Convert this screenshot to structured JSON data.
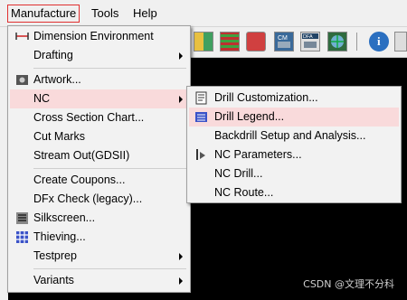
{
  "menubar": {
    "items": [
      "Manufacture",
      "Tools",
      "Help"
    ]
  },
  "main_menu": {
    "items": [
      {
        "label": "Dimension Environment",
        "icon": "dimension-icon"
      },
      {
        "label": "Drafting",
        "submenu": true
      },
      {
        "label": "Artwork...",
        "icon": "artwork-icon"
      },
      {
        "label": "NC",
        "submenu": true,
        "highlighted": true
      },
      {
        "label": "Cross Section Chart..."
      },
      {
        "label": "Cut Marks"
      },
      {
        "label": "Stream Out(GDSII)"
      },
      {
        "label": "Create Coupons..."
      },
      {
        "label": "DFx Check (legacy)..."
      },
      {
        "label": "Silkscreen...",
        "icon": "silkscreen-icon"
      },
      {
        "label": "Thieving...",
        "icon": "thieving-icon"
      },
      {
        "label": "Testprep",
        "submenu": true
      },
      {
        "label": "Variants",
        "submenu": true
      }
    ]
  },
  "nc_submenu": {
    "items": [
      {
        "label": "Drill Customization...",
        "icon": "drill-customization-icon"
      },
      {
        "label": "Drill Legend...",
        "icon": "drill-legend-icon",
        "highlighted": true
      },
      {
        "label": "Backdrill Setup and Analysis..."
      },
      {
        "label": "NC Parameters...",
        "icon": "nc-parameters-icon"
      },
      {
        "label": "NC Drill..."
      },
      {
        "label": "NC Route..."
      }
    ]
  },
  "toolbar": {
    "buttons": [
      "toolbar-grid-icon",
      "toolbar-layers-icon",
      "toolbar-shapes-icon",
      "toolbar-cm-icon",
      "toolbar-dfa-icon",
      "toolbar-3d-icon",
      "toolbar-info-icon",
      "toolbar-extra-icon"
    ]
  },
  "watermark": "CSDN @文理不分科",
  "colors": {
    "highlight": "#f9dadb",
    "menu_bg": "#f2f2f2",
    "active_border": "#e03030"
  }
}
